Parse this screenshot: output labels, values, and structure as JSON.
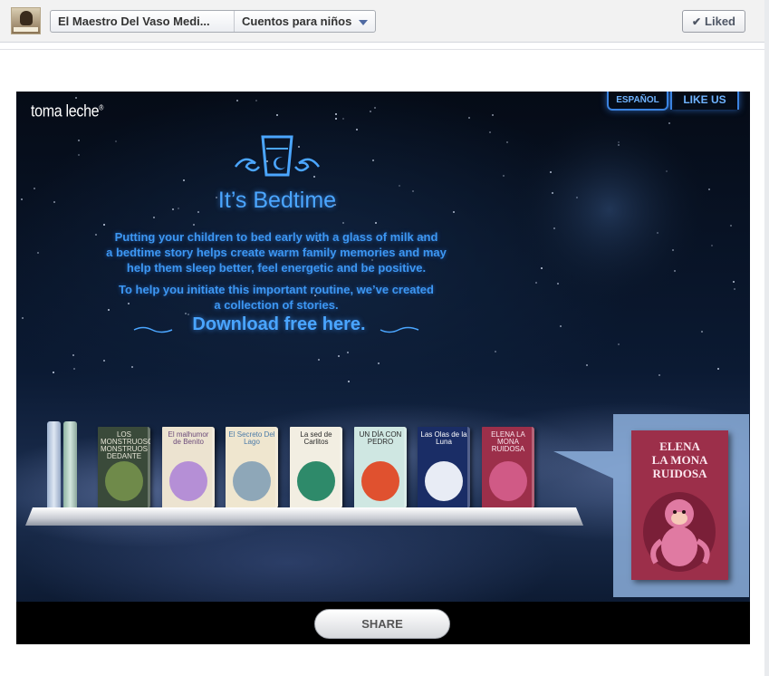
{
  "header": {
    "page_name": "El Maestro Del Vaso Medi...",
    "tab_name": "Cuentos para niños",
    "liked_label": "Liked"
  },
  "app": {
    "brand": "toma leche",
    "brand_mark": "®",
    "lang_button": "ESPAÑOL",
    "like_us_button": "LIKE US",
    "headline": "It’s Bedtime",
    "intro_line1": "Putting your children to bed early with a glass of milk and",
    "intro_line2": "a bedtime story helps create warm family memories and may",
    "intro_line3": "help them sleep better, feel energetic and be positive.",
    "routine_line1": "To help you initiate this important routine, we’ve created",
    "routine_line2": "a collection of stories.",
    "download_label": "Download free here.",
    "share_label": "SHARE",
    "accent_color": "#3d97f2"
  },
  "books": [
    {
      "title": "LOS MONSTRUOSOS MONSTRUOS DEDANTE",
      "cover": "#3a4a3a",
      "text_color": "#e8e6d8",
      "pic": "#6f8a4a"
    },
    {
      "title": "El malhumor de Benito",
      "cover": "#ece3d0",
      "text_color": "#6b4b7a",
      "pic": "#b58fd6"
    },
    {
      "title": "El Secreto Del Lago",
      "cover": "#efe6cf",
      "text_color": "#4a7aa8",
      "pic": "#8ea7b8"
    },
    {
      "title": "La sed de Carlitos",
      "cover": "#f2eee2",
      "text_color": "#2b2b2b",
      "pic": "#2e8a6a"
    },
    {
      "title": "UN DÍA CON PEDRO",
      "cover": "#cfe7e2",
      "text_color": "#2b2b2b",
      "pic": "#e0512f"
    },
    {
      "title": "Las Olas de la Luna",
      "cover": "#1a2d66",
      "text_color": "#ffffff",
      "pic": "#e8ecf5"
    },
    {
      "title": "ELENA LA MONA RUIDOSA",
      "cover": "#9c2f4a",
      "text_color": "#fbe7ef",
      "pic": "#d05a86"
    }
  ],
  "featured_book": {
    "title_line1": "ELENA",
    "title_line2": "LA MONA",
    "title_line3": "RUIDOSA"
  }
}
